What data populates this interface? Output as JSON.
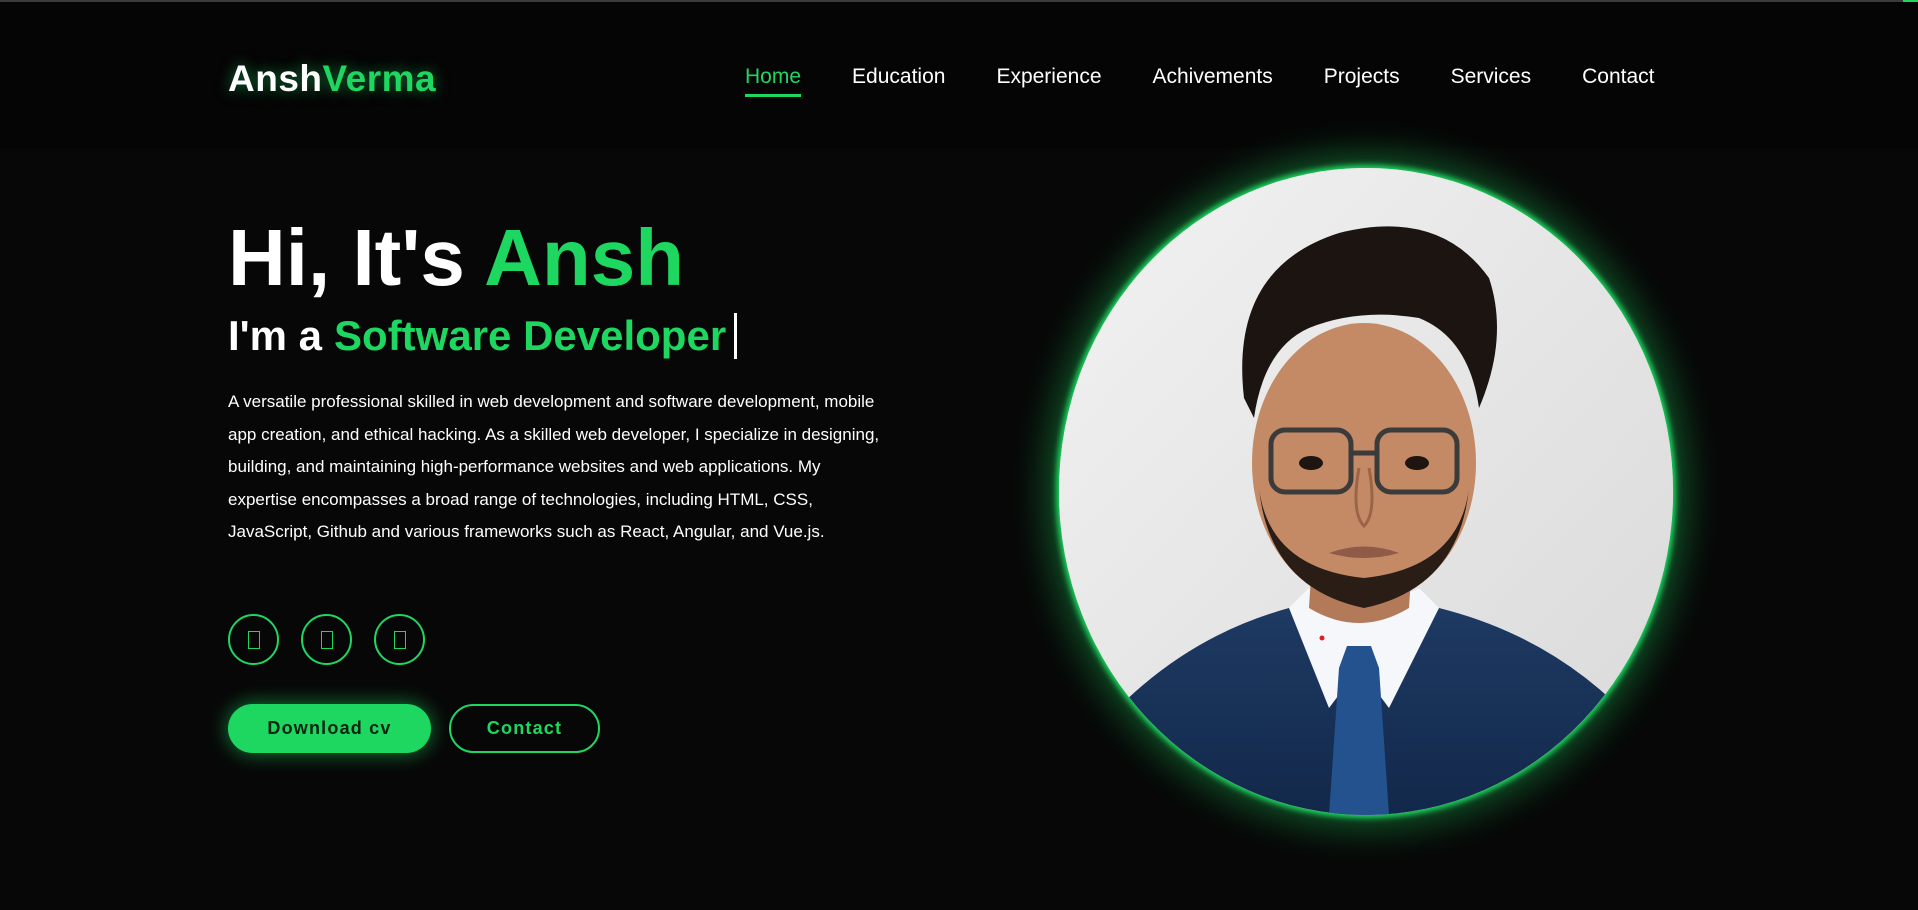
{
  "header": {
    "logo_first": "Ansh",
    "logo_last": "Verma",
    "nav": [
      {
        "label": "Home",
        "active": true
      },
      {
        "label": "Education",
        "active": false
      },
      {
        "label": "Experience",
        "active": false
      },
      {
        "label": "Achivements",
        "active": false
      },
      {
        "label": "Projects",
        "active": false
      },
      {
        "label": "Services",
        "active": false
      },
      {
        "label": "Contact",
        "active": false
      }
    ]
  },
  "hero": {
    "greeting": "Hi, It's",
    "name": "Ansh",
    "sub_prefix": "I'm a",
    "role": "Software Developer",
    "description": "A versatile professional skilled in web development and software development, mobile app creation, and ethical hacking. As a skilled web developer, I specialize in designing, building, and maintaining high-performance websites and web applications. My expertise encompasses a broad range of technologies, including HTML, CSS, JavaScript, Github and various frameworks such as React, Angular, and Vue.js.",
    "social_icons": [
      "social-icon-1",
      "social-icon-2",
      "social-icon-3"
    ],
    "buttons": {
      "primary": "Download cv",
      "secondary": "Contact"
    }
  },
  "colors": {
    "accent": "#1ed760",
    "background": "#070707",
    "text": "#ffffff"
  }
}
